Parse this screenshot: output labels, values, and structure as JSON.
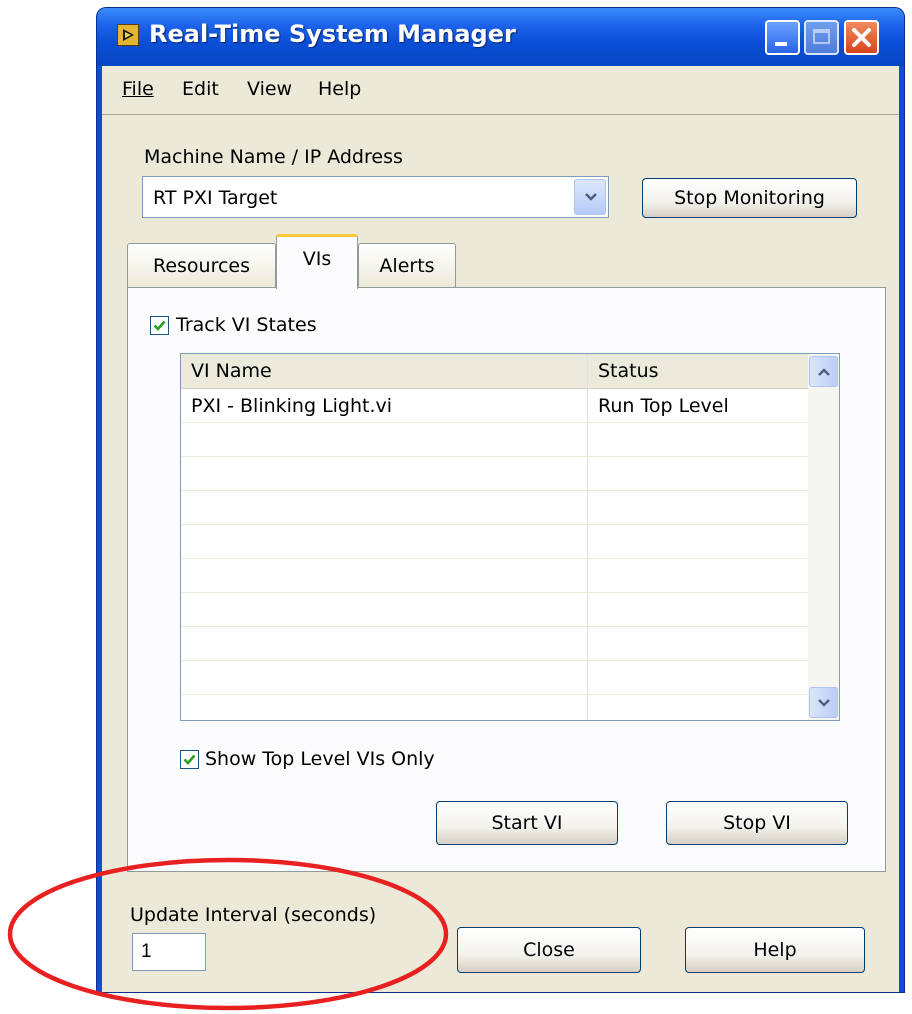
{
  "window": {
    "title": "Real-Time System Manager"
  },
  "menu": {
    "file": "File",
    "edit": "Edit",
    "view": "View",
    "help": "Help"
  },
  "machine": {
    "label": "Machine Name / IP Address",
    "value": "RT PXI Target",
    "stop_monitoring": "Stop Monitoring"
  },
  "tabs": [
    {
      "label": "Resources",
      "active": false
    },
    {
      "label": "VIs",
      "active": true
    },
    {
      "label": "Alerts",
      "active": false
    }
  ],
  "vis_panel": {
    "track_states_label": "Track VI States",
    "track_states_checked": true,
    "columns": [
      "VI Name",
      "Status"
    ],
    "rows": [
      {
        "name": "PXI - Blinking Light.vi",
        "status": "Run Top Level"
      }
    ],
    "show_top_level_label": "Show Top Level VIs Only",
    "show_top_level_checked": true,
    "start_vi": "Start VI",
    "stop_vi": "Stop VI"
  },
  "footer": {
    "update_interval_label": "Update Interval (seconds)",
    "update_interval_value": "1",
    "close": "Close",
    "help": "Help"
  },
  "colors": {
    "title_bar": "#0b4fd6",
    "dialog_face": "#ece9d8",
    "annotation": "#e8201f"
  },
  "annotation": {
    "shape": "ellipse",
    "target": "update-interval"
  }
}
